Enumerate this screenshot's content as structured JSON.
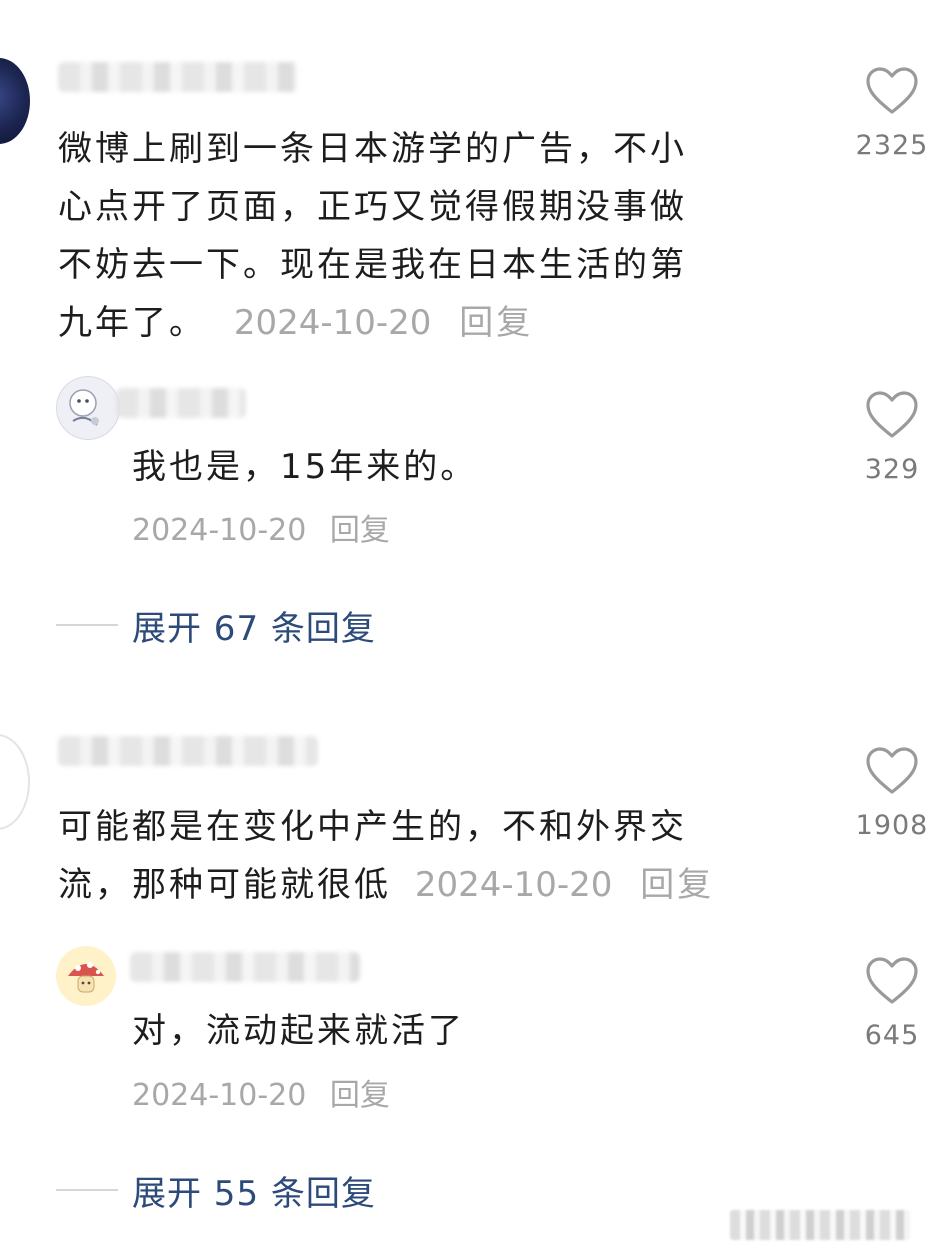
{
  "comments": [
    {
      "id": "comment-1",
      "text": "微博上刷到一条日本游学的广告，不小心点开了页面，正巧又觉得假期没事做不妨去一下。现在是我在日本生活的第九年了。",
      "lines": [
        "微博上刷到一条日本游学的广告，不小",
        "心点开了页面，正巧又觉得假期没事做",
        "不妨去一下。现在是我在日本生活的第",
        "九年了。"
      ],
      "date": "2024-10-20",
      "reply_label": "回复",
      "likes": "2325",
      "replies": [
        {
          "id": "reply-1",
          "text": "我也是，15年来的。",
          "date": "2024-10-20",
          "reply_label": "回复",
          "likes": "329"
        }
      ],
      "expand_label": "展开 67 条回复"
    },
    {
      "id": "comment-2",
      "text": "可能都是在变化中产生的，不和外界交流，那种可能就很低",
      "lines": [
        "可能都是在变化中产生的，不和外界交",
        "流，那种可能就很低"
      ],
      "date": "2024-10-20",
      "reply_label": "回复",
      "likes": "1908",
      "replies": [
        {
          "id": "reply-2",
          "text": "对，流动起来就活了",
          "date": "2024-10-20",
          "reply_label": "回复",
          "likes": "645"
        }
      ],
      "expand_label": "展开 55 条回复"
    }
  ],
  "icons": {
    "like": "heart-outline-icon"
  },
  "colors": {
    "text": "#1d1d1d",
    "meta": "#a8a8a8",
    "expand_link": "#2c4a7a",
    "like_count": "#7a7a7a"
  }
}
